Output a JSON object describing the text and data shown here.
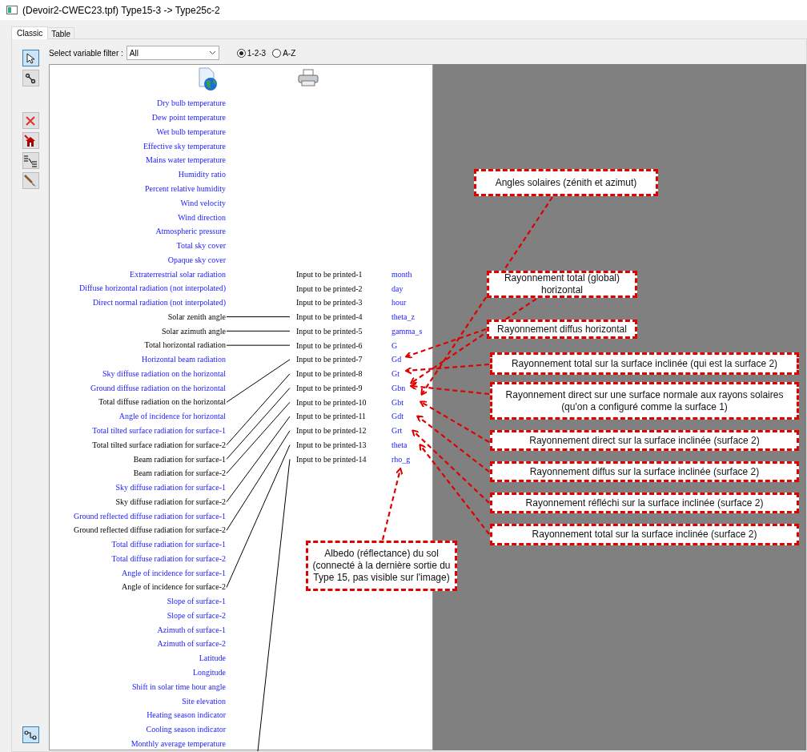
{
  "window": {
    "title": "(Devoir2-CWEC23.tpf) Type15-3 -> Type25c-2"
  },
  "tabs": [
    {
      "label": "Classic",
      "selected": true
    },
    {
      "label": "Table",
      "selected": false
    }
  ],
  "toolbar": [
    {
      "kind": "pointer",
      "selected": true
    },
    {
      "kind": "link",
      "selected": false
    },
    {
      "kind": "delete",
      "selected": false
    },
    {
      "kind": "delete-all",
      "selected": false
    },
    {
      "kind": "list",
      "selected": false
    },
    {
      "kind": "brush",
      "selected": false
    },
    {
      "kind": "connect",
      "selected": true
    }
  ],
  "filter": {
    "label": "Select variable filter :",
    "value": "All"
  },
  "order_options": [
    {
      "label": "1-2-3",
      "selected": true
    },
    {
      "label": "A-Z",
      "selected": false
    }
  ],
  "outputs": [
    {
      "label": "Dry bulb temperature",
      "connected": false
    },
    {
      "label": "Dew point temperature",
      "connected": false
    },
    {
      "label": "Wet bulb temperature",
      "connected": false
    },
    {
      "label": "Effective sky temperature",
      "connected": false
    },
    {
      "label": "Mains water temperature",
      "connected": false
    },
    {
      "label": "Humidity ratio",
      "connected": false
    },
    {
      "label": "Percent relative humidity",
      "connected": false
    },
    {
      "label": "Wind velocity",
      "connected": false
    },
    {
      "label": "Wind direction",
      "connected": false
    },
    {
      "label": "Atmospheric pressure",
      "connected": false
    },
    {
      "label": "Total sky cover",
      "connected": false
    },
    {
      "label": "Opaque sky cover",
      "connected": false
    },
    {
      "label": "Extraterrestrial solar radiation",
      "connected": false
    },
    {
      "label": "Diffuse horizontal radiation (not interpolated)",
      "connected": false
    },
    {
      "label": "Direct normal radiation (not interpolated)",
      "connected": false
    },
    {
      "label": "Solar zenith angle",
      "connected": true
    },
    {
      "label": "Solar azimuth angle",
      "connected": true
    },
    {
      "label": "Total horizontal radiation",
      "connected": true
    },
    {
      "label": "Horizontal beam radiation",
      "connected": false
    },
    {
      "label": "Sky diffuse radiation on the horizontal",
      "connected": false
    },
    {
      "label": "Ground diffuse radiation on the horizontal",
      "connected": false
    },
    {
      "label": "Total diffuse radiation on the horizontal",
      "connected": true
    },
    {
      "label": "Angle of incidence for horizontal",
      "connected": false
    },
    {
      "label": "Total tilted surface radiation for surface-1",
      "connected": false
    },
    {
      "label": "Total tilted surface radiation for surface-2",
      "connected": true
    },
    {
      "label": "Beam radiation for surface-1",
      "connected": true
    },
    {
      "label": "Beam radiation for surface-2",
      "connected": true
    },
    {
      "label": "Sky diffuse radiation for surface-1",
      "connected": false
    },
    {
      "label": "Sky diffuse radiation for surface-2",
      "connected": true
    },
    {
      "label": "Ground reflected diffuse radiation for surface-1",
      "connected": false
    },
    {
      "label": "Ground reflected diffuse radiation for surface-2",
      "connected": true
    },
    {
      "label": "Total diffuse radiation for surface-1",
      "connected": false
    },
    {
      "label": "Total diffuse radiation for surface-2",
      "connected": false
    },
    {
      "label": "Angle of incidence for surface-1",
      "connected": false
    },
    {
      "label": "Angle of incidence for surface-2",
      "connected": true
    },
    {
      "label": "Slope of surface-1",
      "connected": false
    },
    {
      "label": "Slope of surface-2",
      "connected": false
    },
    {
      "label": "Azimuth of surface-1",
      "connected": false
    },
    {
      "label": "Azimuth of surface-2",
      "connected": false
    },
    {
      "label": "Latitude",
      "connected": false
    },
    {
      "label": "Longitude",
      "connected": false
    },
    {
      "label": "Shift in solar time hour angle",
      "connected": false
    },
    {
      "label": "Site elevation",
      "connected": false
    },
    {
      "label": "Heating season indicator",
      "connected": false
    },
    {
      "label": "Cooling season indicator",
      "connected": false
    },
    {
      "label": "Monthly average temperature",
      "connected": false
    }
  ],
  "inputs": [
    {
      "kind": "free",
      "label": "Input to be printed-1",
      "variable": "month"
    },
    {
      "kind": "free",
      "label": "Input to be printed-2",
      "variable": "day"
    },
    {
      "kind": "free",
      "label": "Input to be printed-3",
      "variable": "hour"
    },
    {
      "kind": "wired",
      "label": "Input to be printed-4",
      "variable": "theta_z"
    },
    {
      "kind": "wired",
      "label": "Input to be printed-5",
      "variable": "gamma_s"
    },
    {
      "kind": "wired",
      "label": "Input to be printed-6",
      "variable": "G"
    },
    {
      "kind": "wired",
      "label": "Input to be printed-7",
      "variable": "Gd"
    },
    {
      "kind": "wired",
      "label": "Input to be printed-8",
      "variable": "Gt"
    },
    {
      "kind": "wired",
      "label": "Input to be printed-9",
      "variable": "Gbn"
    },
    {
      "kind": "wired",
      "label": "Input to be printed-10",
      "variable": "Gbt"
    },
    {
      "kind": "wired",
      "label": "Input to be printed-11",
      "variable": "Gdt"
    },
    {
      "kind": "wired",
      "label": "Input to be printed-12",
      "variable": "Grt"
    },
    {
      "kind": "wired",
      "label": "Input to be printed-13",
      "variable": "theta"
    },
    {
      "kind": "offscreen-wired",
      "label": "Input to be printed-14",
      "variable": "rho_g"
    }
  ],
  "annotations": [
    {
      "text": "Angles solaires (zénith et azimut)"
    },
    {
      "text": "Rayonnement total (global) horizontal"
    },
    {
      "text": "Rayonnement diffus horizontal"
    },
    {
      "text": "Rayonnement total sur la surface inclinée (qui est la surface 2)"
    },
    {
      "text": "Rayonnement direct sur une surface normale aux rayons solaires (qu'on a configuré comme la surface 1)"
    },
    {
      "text": "Rayonnement direct sur la surface inclinée (surface 2)"
    },
    {
      "text": "Rayonnement diffus sur la surface inclinée (surface 2)"
    },
    {
      "text": "Rayonnement réfléchi sur la surface inclinée (surface 2)"
    },
    {
      "text": "Rayonnement total sur la surface inclinée (surface 2)"
    },
    {
      "text": "Albedo (réflectance) du sol (connecté à la dernière sortie du Type 15, pas visible sur l'image)"
    }
  ]
}
